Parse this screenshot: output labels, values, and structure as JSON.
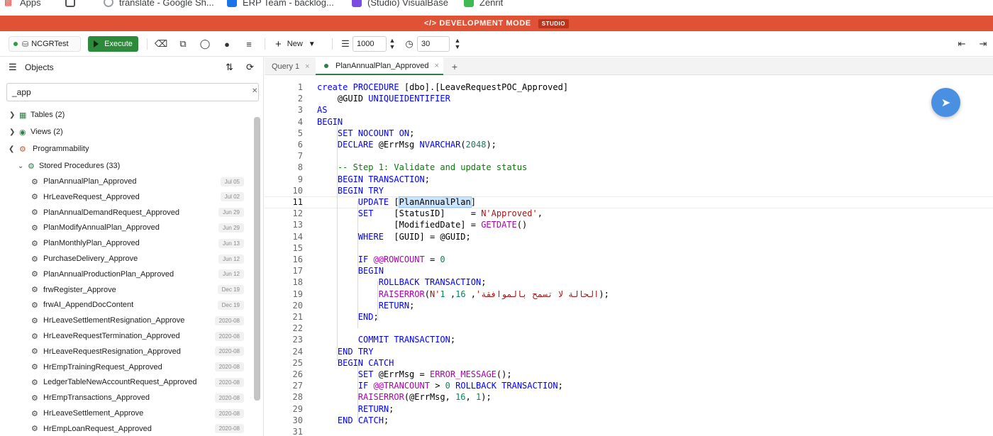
{
  "bookmarks": [
    {
      "label": "Apps",
      "color": "#e8453c"
    },
    {
      "label": "translate - Google Sh...",
      "color": "#9aa0a6"
    },
    {
      "label": "ERP Team - backlog...",
      "color": "#1a73e8"
    },
    {
      "label": "(Studio) VisualBase",
      "color": "#7b4ce0"
    },
    {
      "label": "Zenrit",
      "color": "#3fb950"
    }
  ],
  "dev_banner": {
    "label": "</> DEVELOPMENT MODE",
    "tag": "STUDIO",
    "color": "#e05236"
  },
  "toolbar": {
    "database": "NCGRTest",
    "execute_label": "Execute",
    "new_label": "New",
    "row_limit": "1000",
    "timeout": "30",
    "icons": [
      "eraser-icon",
      "copy-icon",
      "hide-icon",
      "comment-icon",
      "format-icon",
      "plus-icon",
      "chevron-down-icon",
      "settings-icon",
      "clock-icon",
      "import-icon",
      "export-icon"
    ]
  },
  "sidebar": {
    "title": "Objects",
    "search_value": "_app",
    "tree": {
      "tables": "Tables (2)",
      "views": "Views (2)",
      "programmability": "Programmability",
      "stored_procedures": "Stored Procedures (33)"
    },
    "procedures": [
      {
        "name": "PlanAnnualPlan_Approved",
        "date": "Jul 05"
      },
      {
        "name": "HrLeaveRequest_Approved",
        "date": "Jul 02"
      },
      {
        "name": "PlanAnnualDemandRequest_Approved",
        "date": "Jun 29"
      },
      {
        "name": "PlanModifyAnnualPlan_Approved",
        "date": "Jun 29"
      },
      {
        "name": "PlanMonthlyPlan_Approved",
        "date": "Jun 13"
      },
      {
        "name": "PurchaseDelivery_Approve",
        "date": "Jun 12"
      },
      {
        "name": "PlanAnnualProductionPlan_Approved",
        "date": "Jun 12"
      },
      {
        "name": "frwRegister_Approve",
        "date": "Dec 19"
      },
      {
        "name": "frwAI_AppendDocContent",
        "date": "Dec 19"
      },
      {
        "name": "HrLeaveSettlementResignation_Approve",
        "date": "2020-08"
      },
      {
        "name": "HrLeaveRequestTermination_Approved",
        "date": "2020-08"
      },
      {
        "name": "HrLeaveRequestResignation_Approved",
        "date": "2020-08"
      },
      {
        "name": "HrEmpTrainingRequest_Approved",
        "date": "2020-08"
      },
      {
        "name": "LedgerTableNewAccountRequest_Approved",
        "date": "2020-08"
      },
      {
        "name": "HrEmpTransactions_Approved",
        "date": "2020-08"
      },
      {
        "name": "HrLeaveSettlement_Approve",
        "date": "2020-08"
      },
      {
        "name": "HrEmpLoanRequest_Approved",
        "date": "2020-08"
      }
    ]
  },
  "tabs": [
    {
      "label": "Query 1",
      "close": "×"
    },
    {
      "label": "PlanAnnualPlan_Approved",
      "close": "×"
    }
  ],
  "tab_add": "+",
  "editor": {
    "current_line": 11,
    "lines": [
      "create PROCEDURE [dbo].[LeaveRequestPOC_Approved]",
      "    @GUID UNIQUEIDENTIFIER",
      "AS",
      "BEGIN",
      "    SET NOCOUNT ON;",
      "    DECLARE @ErrMsg NVARCHAR(2048);",
      "",
      "    -- Step 1: Validate and update status",
      "    BEGIN TRANSACTION;",
      "    BEGIN TRY",
      "        UPDATE [PlanAnnualPlan]",
      "        SET    [StatusID]     = N'Approved',",
      "               [ModifiedDate] = GETDATE()",
      "        WHERE  [GUID] = @GUID;",
      "",
      "        IF @@ROWCOUNT = 0",
      "        BEGIN",
      "            ROLLBACK TRANSACTION;",
      "            RAISERROR(N'الحالة لا تسمح بالموافقة', 16, 1);",
      "            RETURN;",
      "        END;",
      "",
      "        COMMIT TRANSACTION;",
      "    END TRY",
      "    BEGIN CATCH",
      "        SET @ErrMsg = ERROR_MESSAGE();",
      "        IF @@TRANCOUNT > 0 ROLLBACK TRANSACTION;",
      "        RAISERROR(@ErrMsg, 16, 1);",
      "        RETURN;",
      "    END CATCH;",
      ""
    ]
  }
}
